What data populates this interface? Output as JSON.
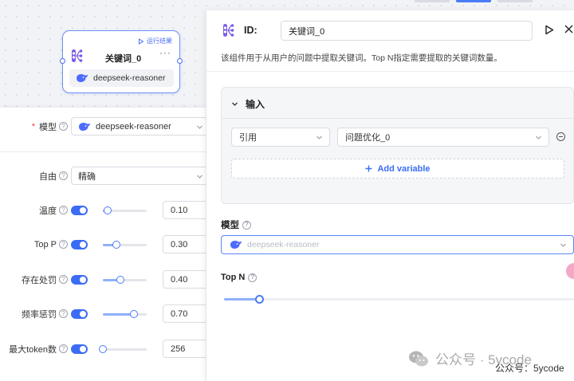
{
  "node": {
    "run_label": "运行结果",
    "title": "关键词_0",
    "more": "···",
    "model": "deepseek-reasoner"
  },
  "left_panel": {
    "model_label": "模型",
    "model_value": "deepseek-reasoner",
    "freedom_label": "自由",
    "freedom_value": "精确",
    "params": [
      {
        "label": "温度",
        "value": "0.10",
        "level": 0.1,
        "enabled": true
      },
      {
        "label": "Top P",
        "value": "0.30",
        "level": 0.3,
        "enabled": true
      },
      {
        "label": "存在处罚",
        "value": "0.40",
        "level": 0.4,
        "enabled": true
      },
      {
        "label": "频率惩罚",
        "value": "0.70",
        "level": 0.7,
        "enabled": true
      },
      {
        "label": "最大token数",
        "value": "256",
        "level": 0.0,
        "enabled": true
      }
    ]
  },
  "right_panel": {
    "id_label": "ID:",
    "id_value": "关键词_0",
    "description": "该组件用于从用户的问题中提取关键词。Top N指定需要提取的关键词数量。",
    "input_section": {
      "title": "输入",
      "ref_select": "引用",
      "var_select": "问题优化_0",
      "add_variable": "Add variable"
    },
    "model_label": "模型",
    "model_placeholder": "deepseek-reasoner",
    "topn_label": "Top N",
    "topn_level": 0.1
  },
  "watermark": {
    "main": "公众号 · 5ycode",
    "sub": "公众号：5ycode"
  },
  "colors": {
    "accent": "#3b6cf6",
    "required": "#e5484d"
  }
}
